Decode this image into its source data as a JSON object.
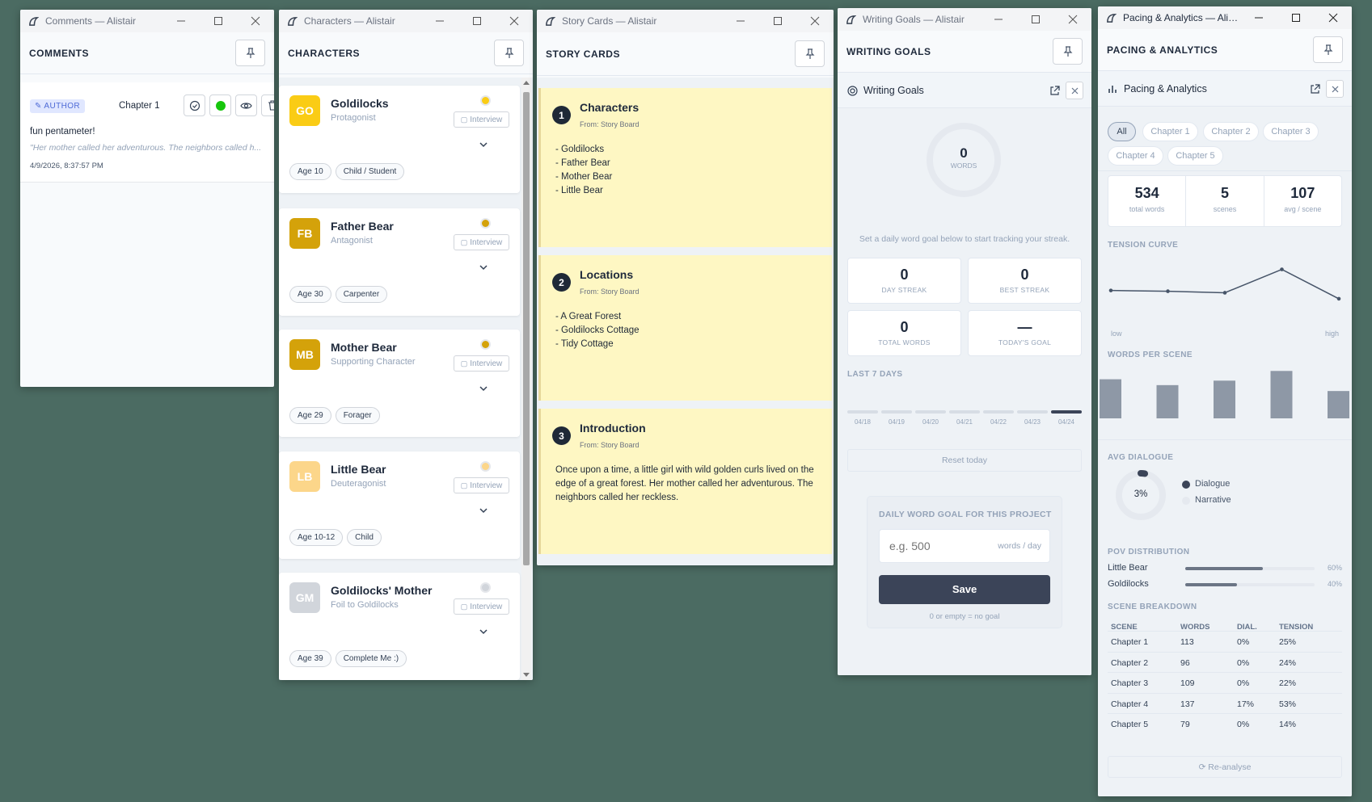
{
  "comments": {
    "window_title": "Comments — Alistair",
    "panel_title": "COMMENTS",
    "author_label": "AUTHOR",
    "chapter": "Chapter 1",
    "comment_text": "fun pentameter!",
    "quote": "\"Her mother called her adventurous. The neighbors called h...",
    "timestamp": "4/9/2026, 8:37:57 PM"
  },
  "characters": {
    "window_title": "Characters — Alistair",
    "panel_title": "CHARACTERS",
    "interview_label": "Interview",
    "items": [
      {
        "initials": "GO",
        "name": "Goldilocks",
        "role": "Protagonist",
        "color": "#facc15",
        "dot": "#facc15",
        "tags": [
          "Age 10",
          "Child / Student"
        ]
      },
      {
        "initials": "FB",
        "name": "Father Bear",
        "role": "Antagonist",
        "color": "#d4a20a",
        "dot": "#d4a20a",
        "tags": [
          "Age 30",
          "Carpenter"
        ]
      },
      {
        "initials": "MB",
        "name": "Mother Bear",
        "role": "Supporting Character",
        "color": "#d4a20a",
        "dot": "#d4a20a",
        "tags": [
          "Age 29",
          "Forager"
        ]
      },
      {
        "initials": "LB",
        "name": "Little Bear",
        "role": "Deuteragonist",
        "color": "#fcd68a",
        "dot": "#fcd68a",
        "tags": [
          "Age 10-12",
          "Child"
        ]
      },
      {
        "initials": "GM",
        "name": "Goldilocks' Mother",
        "role": "Foil to Goldilocks",
        "color": "#d1d5db",
        "dot": "#d1d5db",
        "tags": [
          "Age 39",
          "Complete Me :)"
        ]
      }
    ]
  },
  "story_cards": {
    "window_title": "Story Cards — Alistair",
    "panel_title": "STORY CARDS",
    "cards": [
      {
        "num": "1",
        "title": "Characters",
        "from": "From: Story Board",
        "body": "- Goldilocks\n- Father Bear\n- Mother Bear\n- Little Bear"
      },
      {
        "num": "2",
        "title": "Locations",
        "from": "From: Story Board",
        "body": "- A Great Forest\n- Goldilocks Cottage\n- Tidy Cottage"
      },
      {
        "num": "3",
        "title": "Introduction",
        "from": "From: Story Board",
        "body": "Once upon a time, a little girl with wild golden curls lived on the edge of a great forest. Her mother called her adventurous. The neighbors called her reckless."
      }
    ]
  },
  "writing_goals": {
    "window_title": "Writing Goals — Alistair",
    "panel_title": "WRITING GOALS",
    "sub_title": "Writing Goals",
    "ring_value": "0",
    "ring_label": "WORDS",
    "hint": "Set a daily word goal below to start tracking your streak.",
    "stats": [
      {
        "value": "0",
        "label": "DAY STREAK"
      },
      {
        "value": "0",
        "label": "BEST STREAK"
      },
      {
        "value": "0",
        "label": "TOTAL WORDS"
      },
      {
        "value": "—",
        "label": "TODAY'S GOAL"
      }
    ],
    "last7_label": "LAST 7 DAYS",
    "days": [
      "04/18",
      "04/19",
      "04/20",
      "04/21",
      "04/22",
      "04/23",
      "04/24"
    ],
    "reset_label": "Reset today",
    "goal_title": "DAILY WORD GOAL FOR THIS PROJECT",
    "goal_placeholder": "e.g. 500",
    "goal_unit": "words / day",
    "save_label": "Save",
    "goal_note": "0 or empty = no goal"
  },
  "pacing": {
    "window_title": "Pacing & Analytics — Alis...",
    "panel_title": "PACING & ANALYTICS",
    "sub_title": "Pacing & Analytics",
    "tabs": [
      "All",
      "Chapter 1",
      "Chapter 2",
      "Chapter 3",
      "Chapter 4",
      "Chapter 5"
    ],
    "stats": [
      {
        "value": "534",
        "label": "total words"
      },
      {
        "value": "5",
        "label": "scenes"
      },
      {
        "value": "107",
        "label": "avg / scene"
      }
    ],
    "tension_label": "TENSION CURVE",
    "tension_low": "low",
    "tension_high": "high",
    "tension": [
      25,
      24,
      22,
      53,
      14
    ],
    "wps_label": "WORDS PER SCENE",
    "words": [
      113,
      96,
      109,
      137,
      79
    ],
    "dialogue_label": "AVG DIALOGUE",
    "dialogue_pct": "3%",
    "dialogue_fraction": 0.03,
    "legend_dialogue": "Dialogue",
    "legend_narrative": "Narrative",
    "pov_label": "POV DISTRIBUTION",
    "pov": [
      {
        "name": "Little Bear",
        "pct": "60%",
        "fraction": 0.6
      },
      {
        "name": "Goldilocks",
        "pct": "40%",
        "fraction": 0.4
      }
    ],
    "breakdown_label": "SCENE BREAKDOWN",
    "columns": [
      "SCENE",
      "WORDS",
      "DIAL.",
      "TENSION"
    ],
    "rows": [
      [
        "Chapter 1",
        "113",
        "0%",
        "25%"
      ],
      [
        "Chapter 2",
        "96",
        "0%",
        "24%"
      ],
      [
        "Chapter 3",
        "109",
        "0%",
        "22%"
      ],
      [
        "Chapter 4",
        "137",
        "17%",
        "53%"
      ],
      [
        "Chapter 5",
        "79",
        "0%",
        "14%"
      ]
    ],
    "reanalyse_label": "Re-analyse"
  },
  "colors": {
    "accent": "#3b4458",
    "card_yellow": "#fef7c3",
    "desktop": "#4b6b62"
  }
}
